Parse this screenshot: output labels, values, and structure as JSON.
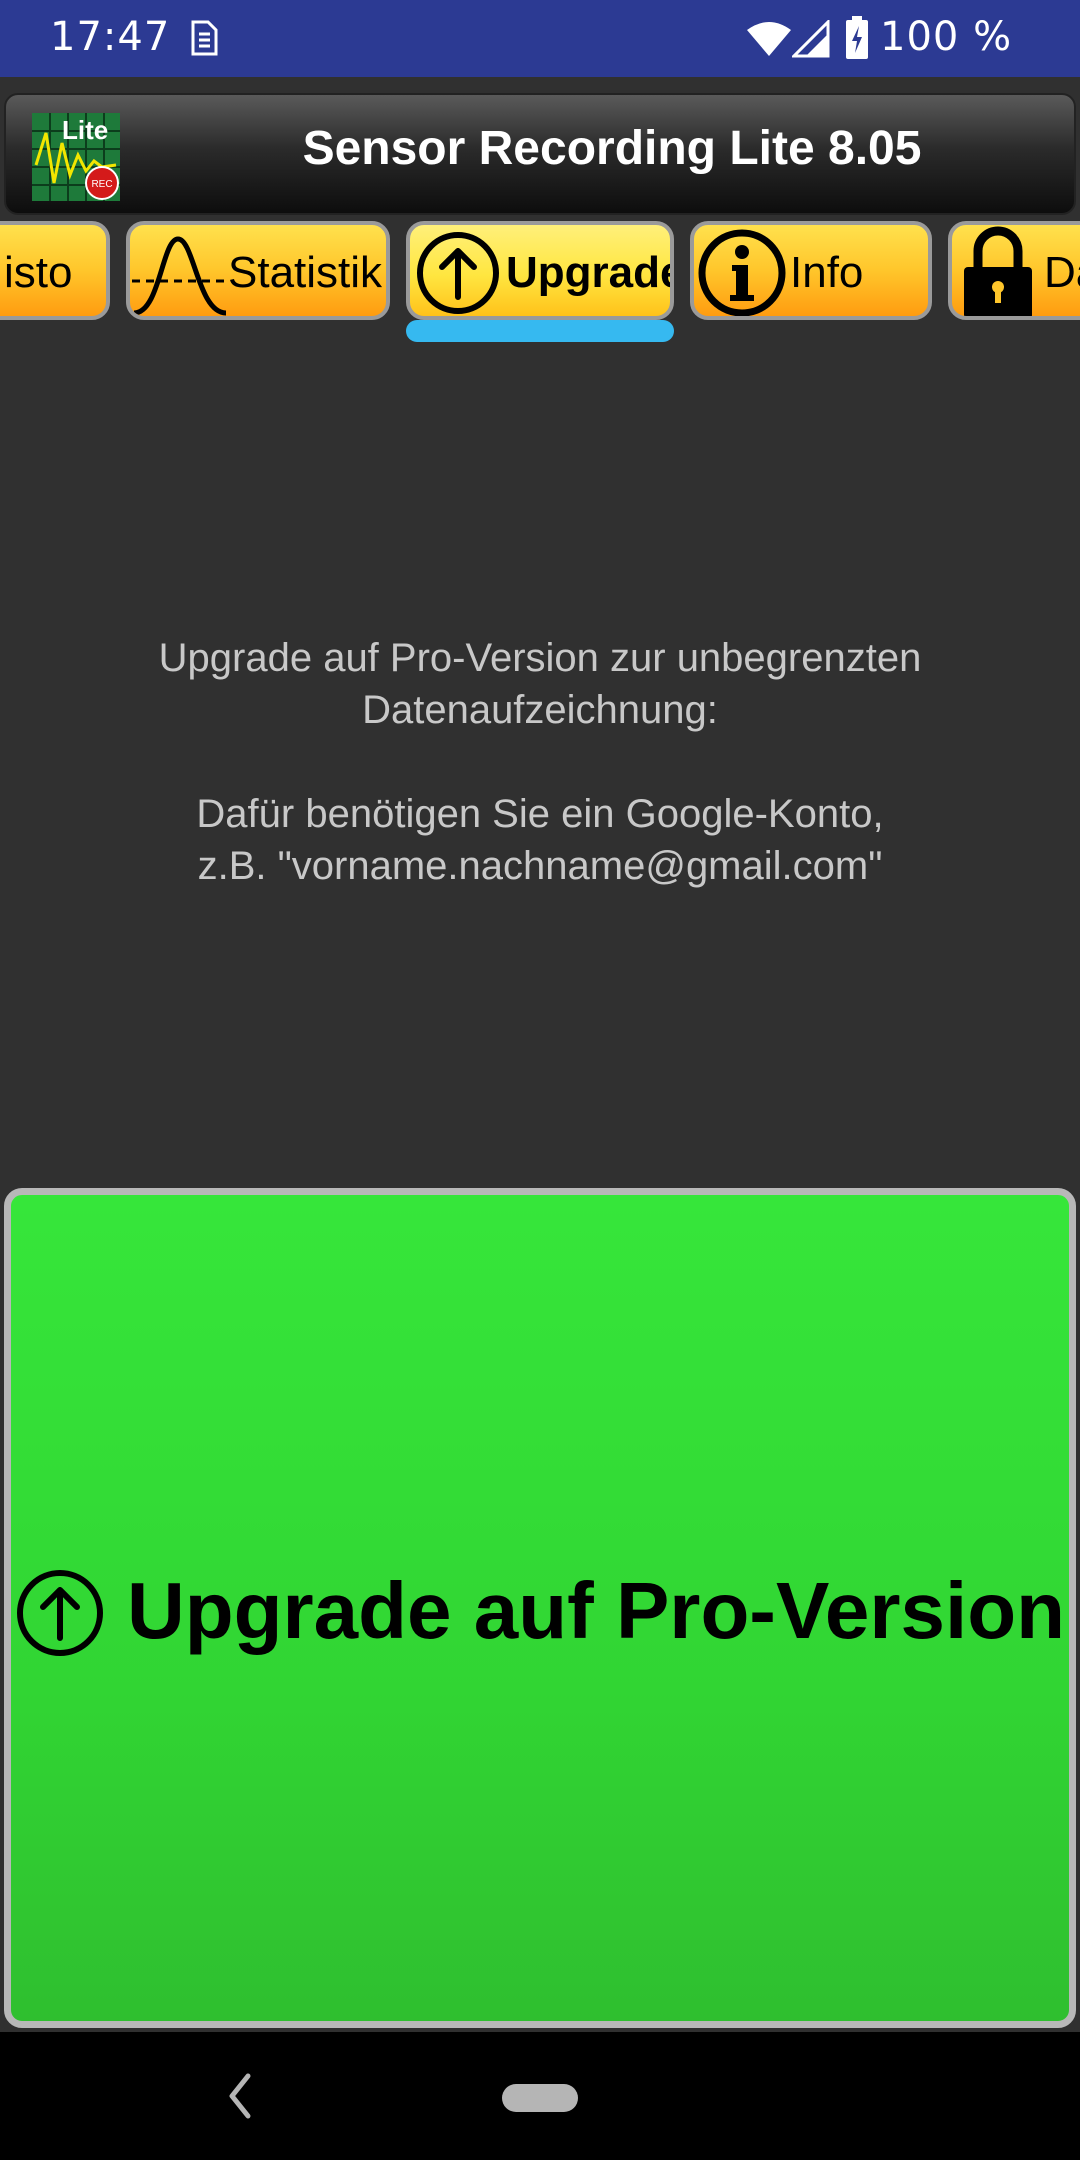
{
  "status_bar": {
    "time": "17:47",
    "battery": "100 %",
    "icons": [
      "sim-icon",
      "wifi-icon",
      "signal-icon",
      "battery-icon"
    ]
  },
  "app": {
    "title": "Sensor Recording Lite 8.05",
    "logo_text": "Lite",
    "logo_badge": "REC"
  },
  "tabs": [
    {
      "label": "isto",
      "icon": ""
    },
    {
      "label": "Statistik",
      "icon": "bell-curve-icon"
    },
    {
      "label": "Upgrade",
      "icon": "arrow-up-circle-icon",
      "active": true
    },
    {
      "label": "Info",
      "icon": "info-icon"
    },
    {
      "label": "Da",
      "icon": "lock-icon"
    }
  ],
  "info": {
    "line1": "Upgrade auf Pro-Version zur unbegrenzten",
    "line2": "Datenaufzeichnung:",
    "line3": "Dafür benötigen Sie ein Google-Konto,",
    "line4": "z.B. \"vorname.nachname@gmail.com\""
  },
  "upgrade_button": {
    "label": "Upgrade auf Pro-Version",
    "icon": "arrow-up-circle-icon"
  },
  "colors": {
    "status_bar": "#2c3a93",
    "background": "#303030",
    "tab_orange": "#ffb020",
    "indicator": "#36b9f0",
    "button_green": "#33dd35"
  }
}
